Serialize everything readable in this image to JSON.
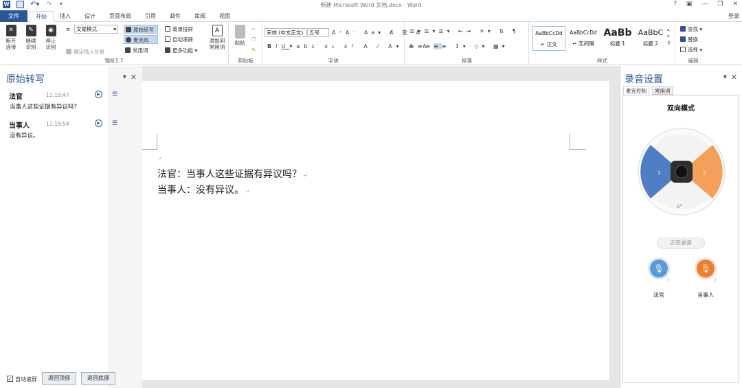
{
  "title": "新建 Microsoft Word 文档.docx - Word",
  "window_controls": [
    "?",
    "▣",
    "—",
    "❐",
    "✕"
  ],
  "login": "登录",
  "tabs": [
    "文件",
    "开始",
    "插入",
    "设计",
    "页面布局",
    "引用",
    "邮件",
    "审阅",
    "视图"
  ],
  "ribbon": {
    "group1": {
      "label": "锦析1.7",
      "disconnect": "断开\n连接",
      "continue": "继续\n识别",
      "stop": "停止\n识别",
      "mode_select": "文尾模式",
      "insert_pos": "确定插入位置",
      "raw_transcript": "原始转写",
      "microphone": "麦克风",
      "common_words": "常用词",
      "record_screen": "笔录投屏",
      "auto_scroll": "自动滚屏",
      "more": "更多功能",
      "add_common": "添加到\n常用词"
    },
    "clipboard": {
      "label": "剪贴板",
      "paste": "粘贴"
    },
    "font": {
      "label": "字体",
      "family": "宋体 (中文正文)",
      "size": "五号"
    },
    "paragraph": {
      "label": "段落"
    },
    "styles": {
      "label": "样式",
      "items": [
        {
          "preview": "AaBbCcDd",
          "name": "↵ 正文"
        },
        {
          "preview": "AaBbCcDd",
          "name": "↵ 无间隔"
        },
        {
          "preview": "AaBb",
          "name": "标题 1"
        },
        {
          "preview": "AaBbC",
          "name": "标题 2"
        }
      ]
    },
    "editing": {
      "label": "编辑",
      "find": "查找",
      "replace": "替换",
      "select": "选择"
    }
  },
  "left_pane": {
    "title": "原始转写",
    "entries": [
      {
        "speaker": "法官",
        "time": "11:19:47",
        "text": "当事人这些证据有异议吗?"
      },
      {
        "speaker": "当事人",
        "time": "11:19:54",
        "text": "没有异议。"
      }
    ],
    "auto_scroll": "自动滚屏",
    "back_top": "返回顶部",
    "back_bottom": "返回底部"
  },
  "document": {
    "lines": [
      "法官：当事人这些证据有异议吗？",
      "当事人：没有异议。"
    ]
  },
  "right_pane": {
    "title": "录音设置",
    "subtabs": [
      "麦克控制",
      "常用词"
    ],
    "mode": "双向模式",
    "dial": {
      "left": "1",
      "right": "2",
      "angle": "0°"
    },
    "recording": "正在录音",
    "mics": [
      {
        "label": "法官",
        "num": "1",
        "color": "#5b9bd5"
      },
      {
        "label": "当事人",
        "num": "2",
        "color": "#ed7d31"
      }
    ]
  }
}
